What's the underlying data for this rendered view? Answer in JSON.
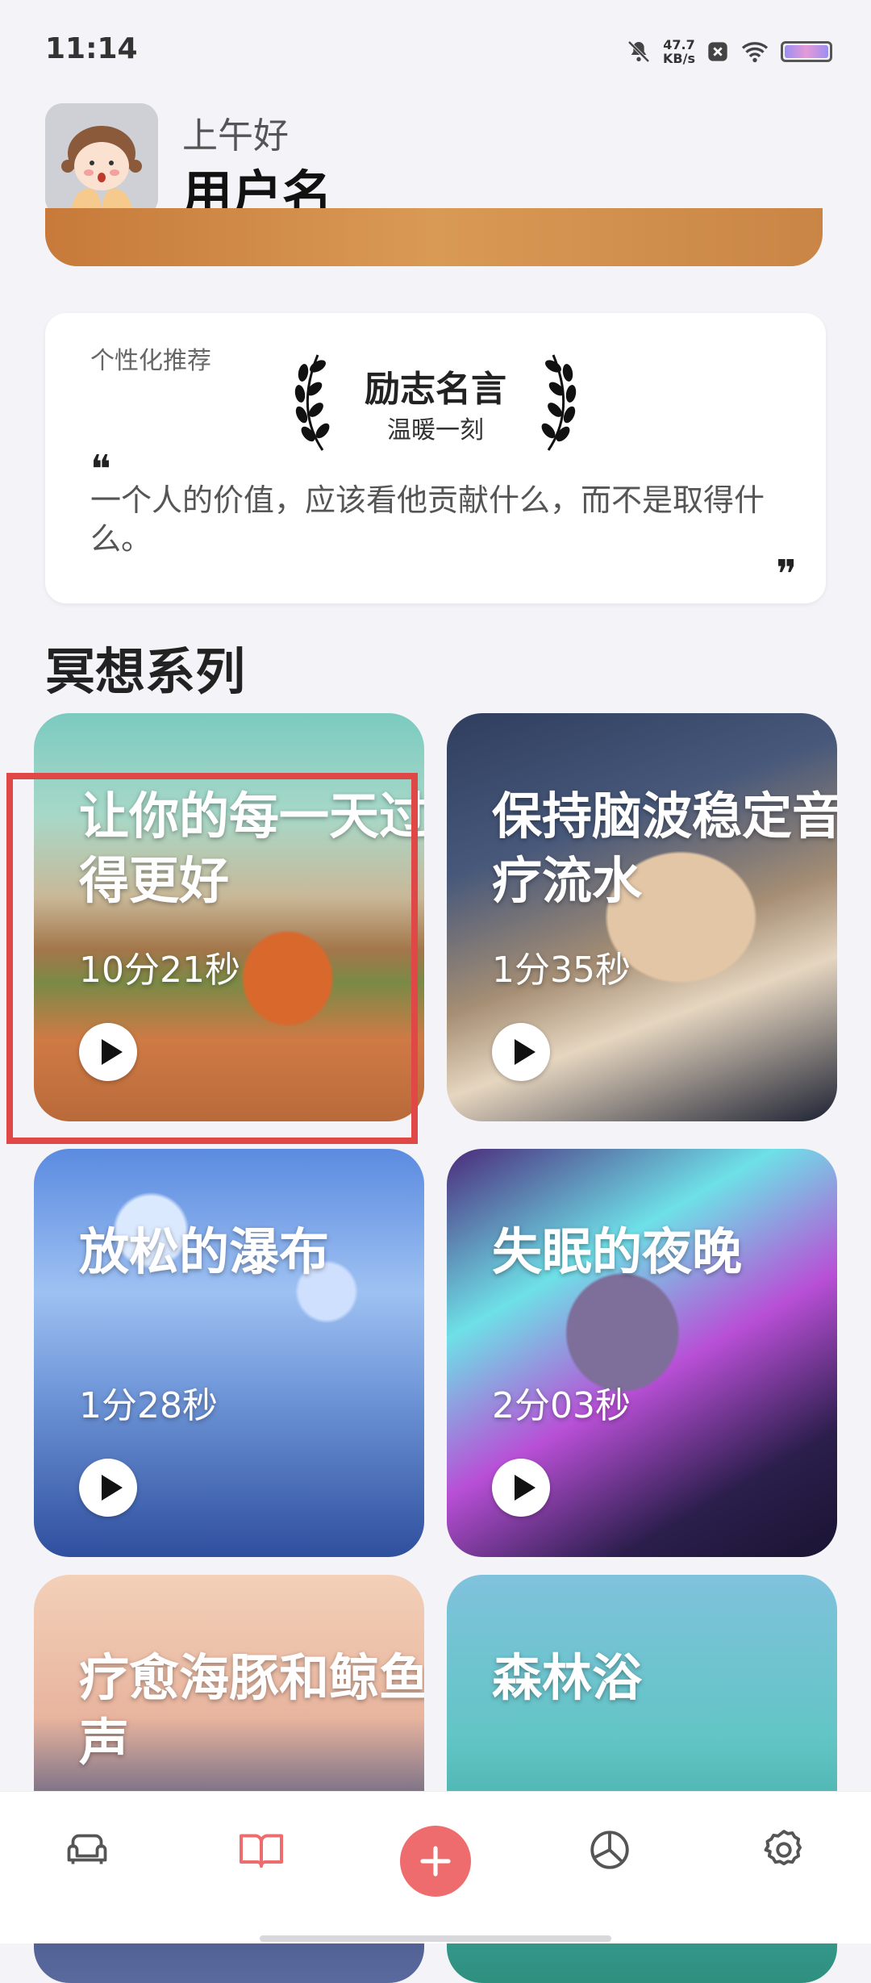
{
  "status": {
    "time": "11:14",
    "net_speed_value": "47.7",
    "net_speed_unit": "KB/s",
    "icons": [
      "mute-bell-icon",
      "close-notification-icon",
      "wifi-icon",
      "battery-icon"
    ]
  },
  "header": {
    "greeting": "上午好",
    "username": "用户名"
  },
  "quote": {
    "kicker": "个性化推荐",
    "title": "励志名言",
    "subtitle": "温暖一刻",
    "open_mark": "❝",
    "text": "一个人的价值，应该看他贡献什么，而不是取得什么。",
    "close_mark": "❞"
  },
  "section": {
    "title": "冥想系列"
  },
  "meditations": [
    {
      "title": "让你的每一天过得更好",
      "duration": "10分21秒"
    },
    {
      "title": "保持脑波稳定音疗流水",
      "duration": "1分35秒"
    },
    {
      "title": "放松的瀑布",
      "duration": "1分28秒"
    },
    {
      "title": "失眠的夜晚",
      "duration": "2分03秒"
    },
    {
      "title": "疗愈海豚和鲸鱼声",
      "duration": ""
    },
    {
      "title": "森林浴",
      "duration": ""
    }
  ],
  "nav": {
    "items": [
      "sofa-icon",
      "book-icon",
      "add-icon",
      "pie-chart-icon",
      "gear-icon"
    ],
    "active_index": 1,
    "accent_color": "#ee6b6e"
  },
  "highlight": {
    "color": "#e04848",
    "target_item": "让你的每一天过得更好"
  }
}
